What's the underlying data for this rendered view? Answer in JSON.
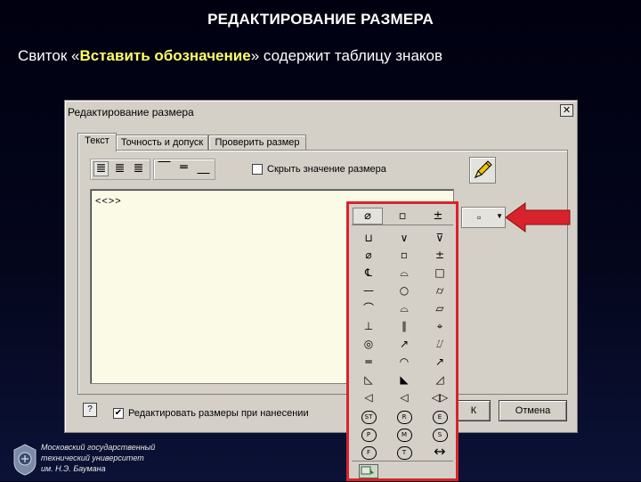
{
  "slide": {
    "title": "РЕДАКТИРОВАНИЕ РАЗМЕРА",
    "subtitle_prefix": "Свиток «",
    "subtitle_highlight": "Вставить обозначение",
    "subtitle_suffix": "» содержит таблицу знаков"
  },
  "dialog": {
    "title": "Редактирование размера",
    "close_symbol": "✕",
    "tabs": [
      "Текст",
      "Точность и допуск",
      "Проверить размер"
    ],
    "active_tab": 0,
    "hide_value_label": "Скрыть значение размера",
    "hide_value_checked": false,
    "text_value": "<<>>",
    "insert_symbol_button": "▫",
    "edit_on_place_label": "Редактировать размеры при нанесении",
    "edit_on_place_checked": true,
    "help_label": "?",
    "ok_fragment": "К",
    "cancel_label": "Отмена"
  },
  "palette": {
    "header": [
      "⌀",
      "▫",
      "±"
    ],
    "rows": [
      [
        "⊔",
        "∨",
        "⊽"
      ],
      [
        "⌀",
        "▫",
        "±"
      ],
      [
        "℄",
        "⌓",
        "□"
      ],
      [
        "—",
        "○",
        "⌭"
      ],
      [
        "⌒",
        "⌓",
        "⏥"
      ],
      [
        "⊥",
        "∥",
        "⌖"
      ],
      [
        "◎",
        "↗",
        "⌰"
      ],
      [
        "═",
        "◠",
        "↗"
      ],
      [
        "◺",
        "◣",
        "◿"
      ],
      [
        "◁",
        "◁",
        "◁▷"
      ]
    ],
    "circled": [
      [
        "ST",
        "R",
        "E"
      ],
      [
        "P",
        "M",
        "S"
      ],
      [
        "F",
        "T",
        "↔"
      ]
    ]
  },
  "logo": {
    "line1": "Московский государственный",
    "line2": "технический университет",
    "line3": "им. Н.Э. Баумана"
  },
  "colors": {
    "highlight": "#ffff66",
    "arrow": "#d8232c",
    "dialog_bg": "#d4d0c8"
  }
}
